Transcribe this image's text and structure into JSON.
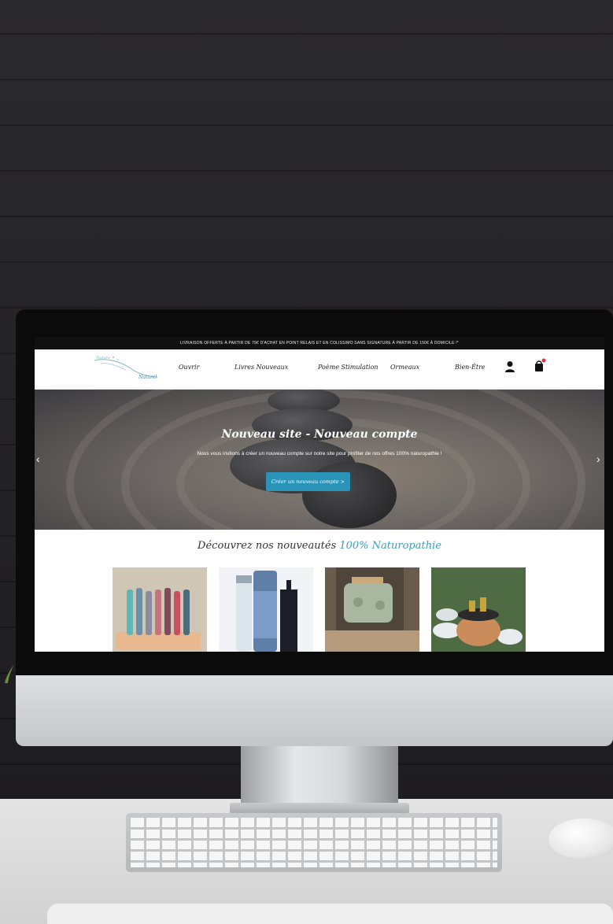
{
  "site": {
    "promo_text": "LIVRAISON OFFERTE À PARTIR DE 79€ D'ACHAT EN POINT RELAIS ET EN COLISSIMO SANS SIGNATURE À PARTIR DE 150€ À DOMICILE !*",
    "logo_text": "Naturel",
    "nav": [
      "Ouvrir",
      "Livres Nouveaux",
      "Poème Stimulation",
      "Ormeaux",
      "Bien-Être"
    ],
    "hero": {
      "title": "Nouveau site - Nouveau compte",
      "subtitle": "Nous vous invitons à créer un nouveau compte sur notre site pour profiter de nos offres 100% naturopathie !",
      "button": "Créer un nouveau compte >"
    },
    "section": {
      "title_main": "Découvrez nos nouveautés",
      "title_accent": "100% Naturopathie"
    },
    "products": [
      "colored-sticks-product",
      "water-bottle-product",
      "green-tin-product",
      "bowl-product"
    ],
    "colors": {
      "accent": "#2a93b8",
      "cart_badge": "#d9364a"
    }
  },
  "icons": [
    "user-icon",
    "cart-icon",
    "chevron-left-icon",
    "chevron-right-icon"
  ]
}
